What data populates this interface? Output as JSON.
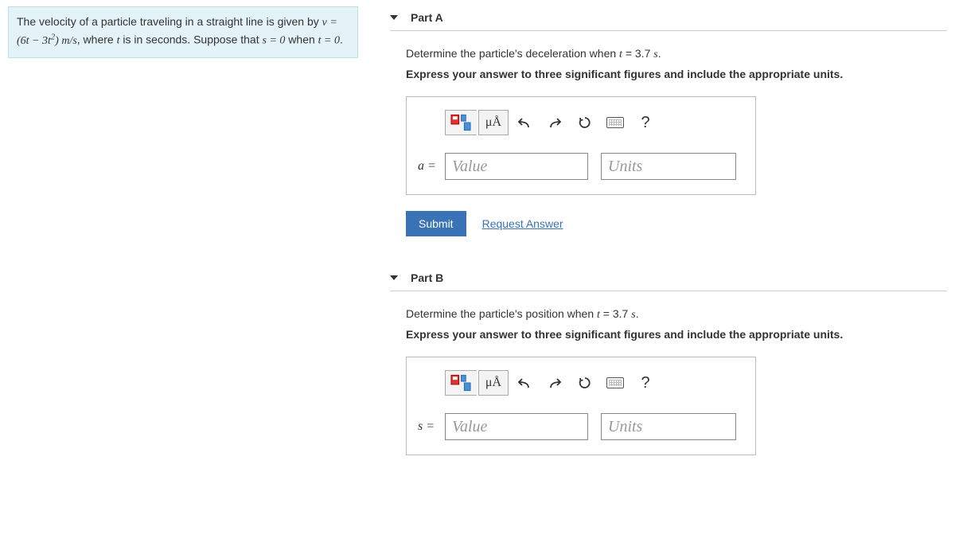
{
  "problem": {
    "line1_pre": "The velocity of a particle traveling in a straight line is given by ",
    "line1_eq": "v = (6t − 3t²) m/s",
    "line1_post": ", where ",
    "line1_var": "t",
    "line1_end": " is in seconds.",
    "line2_pre": "Suppose that ",
    "line2_eq1": "s = 0",
    "line2_mid": " when ",
    "line2_eq2": "t = 0",
    "line2_end": "."
  },
  "partA": {
    "title": "Part A",
    "prompt_pre": "Determine the particle's deceleration when ",
    "prompt_var": "t",
    "prompt_eq": " = 3.7 ",
    "prompt_unit": "s",
    "prompt_end": ".",
    "hint": "Express your answer to three significant figures and include the appropriate units.",
    "var_label": "a =",
    "value_placeholder": "Value",
    "units_placeholder": "Units",
    "submit": "Submit",
    "request": "Request Answer",
    "special_label": "μÅ",
    "help": "?"
  },
  "partB": {
    "title": "Part B",
    "prompt_pre": "Determine the particle's position when ",
    "prompt_var": "t",
    "prompt_eq": " = 3.7 ",
    "prompt_unit": "s",
    "prompt_end": ".",
    "hint": "Express your answer to three significant figures and include the appropriate units.",
    "var_label": "s =",
    "value_placeholder": "Value",
    "units_placeholder": "Units",
    "special_label": "μÅ",
    "help": "?"
  }
}
